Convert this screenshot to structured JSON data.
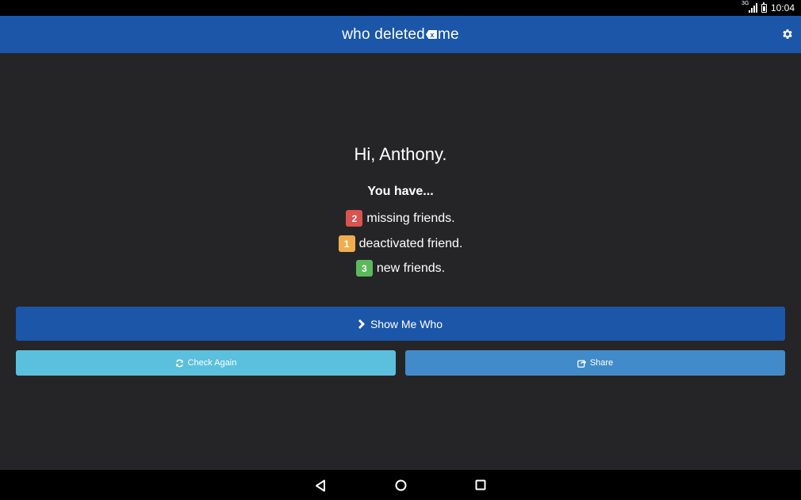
{
  "status_bar": {
    "time": "10:04",
    "network_type": "3G",
    "icons": [
      "signal-icon",
      "battery-icon"
    ]
  },
  "app_bar": {
    "logo_left": "who deleted",
    "logo_mark": "x",
    "logo_right": "me",
    "settings_icon": "gear-icon",
    "color": "#1b56a8"
  },
  "summary": {
    "greeting": "Hi, Anthony.",
    "intro": "You have...",
    "items": [
      {
        "count": "2",
        "text": "missing friends.",
        "color": "#d9534f"
      },
      {
        "count": "1",
        "text": "deactivated friend.",
        "color": "#f0ad4e"
      },
      {
        "count": "3",
        "text": "new friends.",
        "color": "#5cb85c"
      }
    ]
  },
  "actions": {
    "show_me_who": {
      "label": "Show Me Who",
      "icon": "chevron-right-icon",
      "color": "#1b56a8"
    },
    "check_again": {
      "label": "Check Again",
      "icon": "refresh-icon",
      "color": "#5bc0de"
    },
    "share": {
      "label": "Share",
      "icon": "share-icon",
      "color": "#428bca"
    }
  },
  "nav_bar": {
    "icons": [
      "back-icon",
      "home-icon",
      "recents-icon"
    ]
  }
}
